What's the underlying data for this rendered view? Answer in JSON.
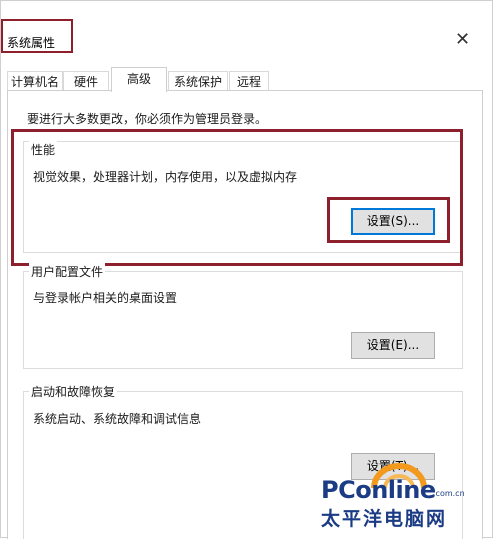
{
  "window": {
    "title": "系统属性",
    "close_icon": "close-icon"
  },
  "tabs": [
    {
      "label": "计算机名"
    },
    {
      "label": "硬件"
    },
    {
      "label": "高级"
    },
    {
      "label": "系统保护"
    },
    {
      "label": "远程"
    }
  ],
  "notice": "要进行大多数更改，你必须作为管理员登录。",
  "performance": {
    "title": "性能",
    "description": "视觉效果，处理器计划，内存使用，以及虚拟内存",
    "button": "设置(S)..."
  },
  "user_profile": {
    "title": "用户配置文件",
    "description": "与登录帐户相关的桌面设置",
    "button": "设置(E)..."
  },
  "startup_recovery": {
    "title": "启动和故障恢复",
    "description": "系统启动、系统故障和调试信息",
    "button": "设置(T)..."
  },
  "watermark": {
    "logo_text": "PConline",
    "domain": ".com.cn",
    "cn_text": "太平洋电脑网"
  },
  "colors": {
    "highlight": "#8e1f2c",
    "brand": "#1b3c85",
    "focus": "#0078d7"
  }
}
